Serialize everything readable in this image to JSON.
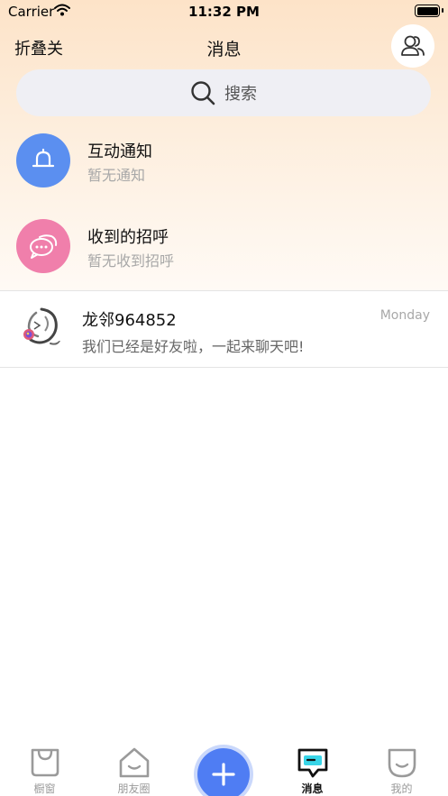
{
  "status_bar": {
    "carrier": "Carrier",
    "time": "11:32 PM"
  },
  "nav": {
    "left_label": "折叠关",
    "title": "消息",
    "right_icon": "contacts-icon"
  },
  "search": {
    "label": "搜索",
    "icon": "search-icon"
  },
  "entries": [
    {
      "title": "互动通知",
      "subtitle": "暂无通知",
      "icon": "bell-icon",
      "color": "#5b8ff0"
    },
    {
      "title": "收到的招呼",
      "subtitle": "暂无收到招呼",
      "icon": "chat-bubble-icon",
      "color": "#f07fab"
    }
  ],
  "chats": [
    {
      "name": "龙邻964852",
      "time": "Monday",
      "preview": "我们已经是好友啦，一起来聊天吧!",
      "avatar": "dragon-avatar"
    }
  ],
  "tabbar": {
    "tabs": [
      {
        "label": "橱窗",
        "icon": "shopping-bag-icon"
      },
      {
        "label": "朋友圈",
        "icon": "house-smile-icon"
      },
      {
        "label": "",
        "icon": "plus-icon"
      },
      {
        "label": "消息",
        "icon": "message-icon",
        "active": true
      },
      {
        "label": "我的",
        "icon": "profile-smile-icon"
      }
    ]
  },
  "colors": {
    "accent": "#4f7df3",
    "notify": "#5b8ff0",
    "greeting": "#f07fab",
    "active_tab_cyan": "#38d5e8"
  }
}
